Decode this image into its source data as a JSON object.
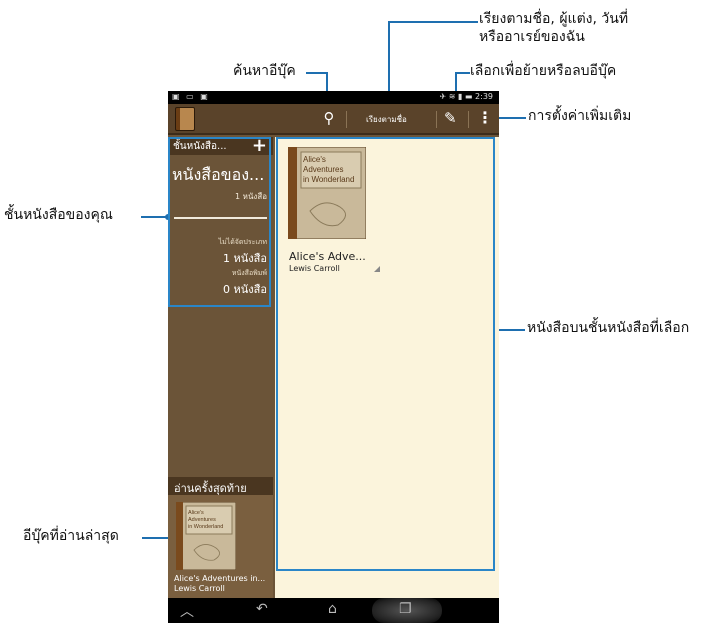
{
  "callouts": {
    "search": "ค้นหาอีบุ๊ค",
    "sort_line1": "เรียงตามชื่อ, ผู้แต่ง, วันที่",
    "sort_line2": "หรืออาเรย์ของฉัน",
    "edit": "เลือกเพื่อย้ายหรือลบอีบุ๊ค",
    "more": "การตั้งค่าเพิ่มเติม",
    "shelf": "ชั้นหนังสือของคุณ",
    "books_on_shelf": "หนังสือบนชั้นหนังสือที่เลือก",
    "recent": "อีบุ๊คที่อ่านล่าสุด"
  },
  "status_bar": {
    "time": "2:39"
  },
  "action_bar": {
    "sort_label": "เรียงตามชื่อ"
  },
  "sidebar": {
    "header": "ชั้นหนังสือ...",
    "add_glyph": "+",
    "shelf_name": "หนังสือของ...",
    "shelf_count": "1 หนังสือ",
    "categories": [
      {
        "label": "ไม่ได้จัดประเภท",
        "value": "1 หนังสือ"
      },
      {
        "label": "หนังสือพิมพ์",
        "value": "0 หนังสือ"
      }
    ],
    "recent_header": "อ่านครั้งสุดท้าย",
    "recent_book": {
      "title": "Alice's Adventures in...",
      "author": "Lewis Carroll"
    }
  },
  "content": {
    "book": {
      "cover_text": "Alice's Adventures in Wonderland",
      "title": "Alice's Adve...",
      "author": "Lewis Carroll"
    }
  },
  "icons": {
    "search": "search-icon",
    "edit": "pencil-icon",
    "more": "overflow-menu-icon",
    "back": "back-icon",
    "home": "home-icon",
    "recents": "recent-apps-icon"
  }
}
